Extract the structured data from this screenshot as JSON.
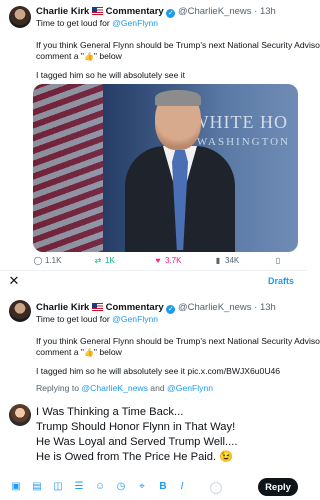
{
  "tweet": {
    "author_name": "Charlie Kirk",
    "author_suffix": "Commentary",
    "handle": "@CharlieK_news",
    "separator": "·",
    "time": "13h",
    "line1_prefix": "Time to get loud for ",
    "line1_mention": "@GenFlynn",
    "body_line2": "If you think General Flynn should be Trump's next National Security Advisor,",
    "body_line3_prefix": "comment a \"",
    "body_line3_emoji": "👍",
    "body_line3_suffix": "\" below",
    "body_line4": "I tagged him so he will absolutely see it",
    "photo_text_1": "WHITE HO",
    "photo_text_2": "WASHINGTON",
    "actions": {
      "replies": "1.1K",
      "retweets": "1K",
      "likes": "3.7K",
      "views": "34K"
    }
  },
  "composer": {
    "close_glyph": "✕",
    "drafts_label": "Drafts",
    "quoted": {
      "author_name": "Charlie Kirk",
      "author_suffix": "Commentary",
      "handle": "@CharlieK_news",
      "separator": "·",
      "time": "13h",
      "line1_prefix": "Time to get loud for ",
      "line1_mention": "@GenFlynn",
      "body_line2": "If you think General Flynn should be Trump's next National Security Advisor,",
      "body_line3_prefix": "comment a \"",
      "body_line3_emoji": "👍",
      "body_line3_suffix": "\" below",
      "body_line4": "I tagged him so he will absolutely see it pic.x.com/BWJX6u0U46"
    },
    "replying_prefix": "Replying to ",
    "replying_to_1": "@CharlieK_news",
    "replying_and": " and ",
    "replying_to_2": "@GenFlynn",
    "reply_lines": [
      "I Was Thinking a Time Back...",
      "Trump Should Honor Flynn in That Way!",
      "He Was Loyal and Served Trump Well....",
      "He is Owed from The Price He Paid. 😉"
    ],
    "reply_button": "Reply"
  },
  "colors": {
    "accent": "#1d9bf0",
    "text": "#0f1419",
    "muted": "#536471",
    "retweet": "#00ba7c",
    "like": "#f91880"
  },
  "icons": {
    "reply": "comment-icon",
    "retweet": "retweet-icon",
    "like": "heart-icon",
    "views": "views-chart-icon",
    "verified": "verified-badge-icon"
  }
}
